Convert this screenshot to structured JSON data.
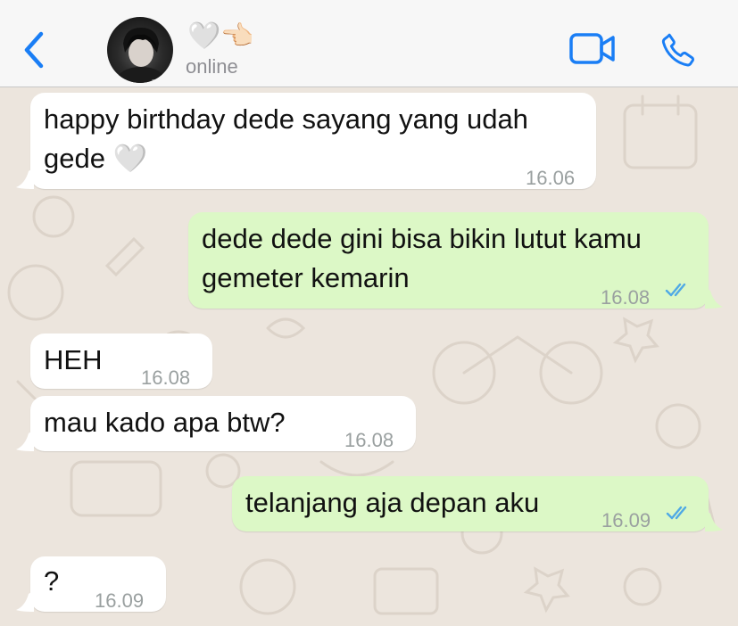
{
  "header": {
    "back_label": "back",
    "contact_name": "🤍👈🏻",
    "status": "online",
    "colors": {
      "accent": "#1A7EF5",
      "header_bg": "#F7F7F7"
    }
  },
  "messages": [
    {
      "direction": "incoming",
      "line1": "happy birthday dede sayang yang udah",
      "line2": "gede 🤍",
      "time": "16.06"
    },
    {
      "direction": "outgoing",
      "line1": "dede dede gini bisa bikin lutut kamu",
      "line2": "gemeter kemarin",
      "time": "16.08",
      "read": true
    },
    {
      "direction": "incoming",
      "text": "HEH",
      "time": "16.08"
    },
    {
      "direction": "incoming",
      "text": "mau kado apa btw?",
      "time": "16.08"
    },
    {
      "direction": "outgoing",
      "text": "telanjang aja depan aku",
      "time": "16.09",
      "read": true
    },
    {
      "direction": "incoming",
      "text": "?",
      "time": "16.09"
    }
  ],
  "colors": {
    "incoming_bubble": "#FFFFFF",
    "outgoing_bubble": "#DCF8C6",
    "wallpaper": "#ECE5DD",
    "read_ticks": "#4FA9E5",
    "timestamp": "#9AA0A0"
  },
  "icons": [
    "back-chevron-icon",
    "video-call-icon",
    "phone-call-icon",
    "double-check-icon"
  ]
}
